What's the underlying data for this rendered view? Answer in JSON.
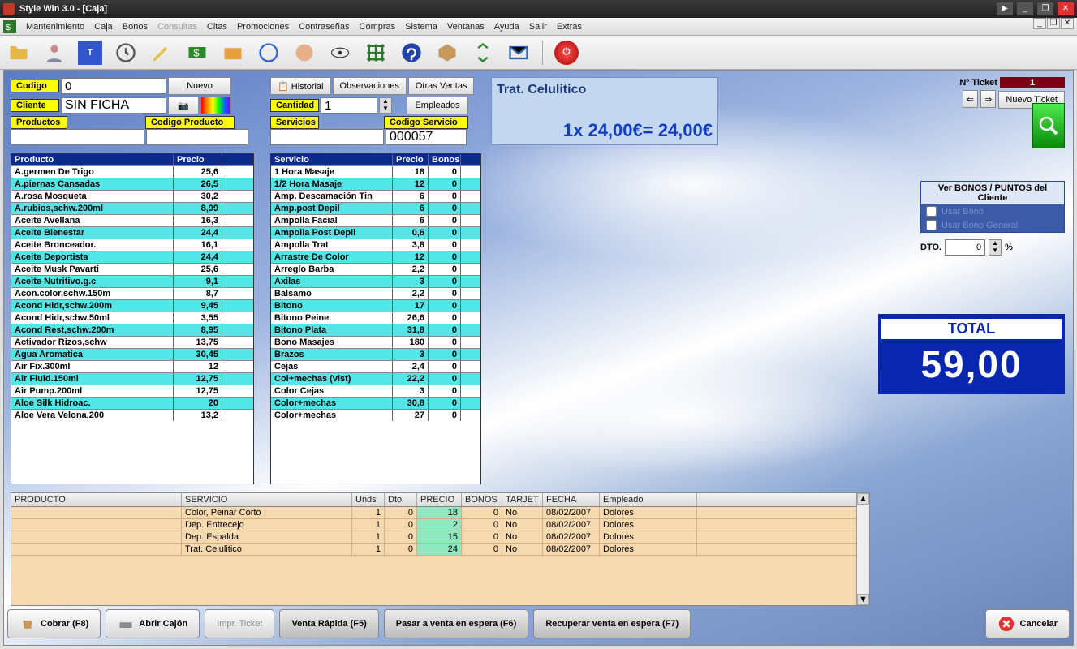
{
  "window": {
    "title": "Style Win 3.0 - [Caja]"
  },
  "menu": [
    "Mantenimiento",
    "Caja",
    "Bonos",
    "Consultas",
    "Citas",
    "Promociones",
    "Contraseñas",
    "Compras",
    "Sistema",
    "Ventanas",
    "Ayuda",
    "Salir",
    "Extras"
  ],
  "menu_disabled_index": 3,
  "top": {
    "codigo_label": "Codigo",
    "codigo_value": "0",
    "nuevo": "Nuevo",
    "cliente_label": "Cliente",
    "cliente_value": "SIN FICHA",
    "historial": "Historial",
    "observaciones": "Observaciones",
    "otras_ventas": "Otras Ventas",
    "cantidad_label": "Cantidad",
    "cantidad_value": "1",
    "empleados": "Empleados",
    "productos_label": "Productos",
    "codigo_producto_label": "Codigo Producto",
    "servicios_label": "Servicios",
    "codigo_servicio_label": "Codigo Servicio",
    "codigo_servicio_value": "000057"
  },
  "display": {
    "line1": "Trat. Celulitico",
    "line2": "1x 24,00€= 24,00€"
  },
  "ticket": {
    "label": "Nº Ticket",
    "number": "1",
    "nuevo": "Nuevo Ticket"
  },
  "right": {
    "ver_bonos": "Ver BONOS / PUNTOS del Cliente",
    "usar_bono": "Usar Bono",
    "usar_bono_gen": "Usar Bono General",
    "dto_label": "DTO.",
    "dto_value": "0",
    "pct": "%"
  },
  "total": {
    "label": "TOTAL",
    "value": "59,00"
  },
  "productos": {
    "hdr_name": "Producto",
    "hdr_price": "Precio",
    "rows": [
      {
        "n": "A.germen De Trigo",
        "p": "25,6"
      },
      {
        "n": "A.piernas Cansadas",
        "p": "26,5"
      },
      {
        "n": "A.rosa Mosqueta",
        "p": "30,2"
      },
      {
        "n": "A.rubios,schw.200ml",
        "p": "8,99"
      },
      {
        "n": "Aceite Avellana",
        "p": "16,3"
      },
      {
        "n": "Aceite Bienestar",
        "p": "24,4"
      },
      {
        "n": "Aceite Bronceador.",
        "p": "16,1"
      },
      {
        "n": "Aceite Deportista",
        "p": "24,4"
      },
      {
        "n": "Aceite Musk Pavarti",
        "p": "25,6"
      },
      {
        "n": "Aceite Nutritivo.g.c",
        "p": "9,1"
      },
      {
        "n": "Acon.color,schw.150m",
        "p": "8,7"
      },
      {
        "n": "Acond Hidr,schw.200m",
        "p": "9,45"
      },
      {
        "n": "Acond Hidr,schw.50ml",
        "p": "3,55"
      },
      {
        "n": "Acond Rest,schw.200m",
        "p": "8,95"
      },
      {
        "n": "Activador Rizos,schw",
        "p": "13,75"
      },
      {
        "n": "Agua Aromatica",
        "p": "30,45"
      },
      {
        "n": "Air Fix.300ml",
        "p": "12"
      },
      {
        "n": "Air Fluid.150ml",
        "p": "12,75"
      },
      {
        "n": "Air Pump.200ml",
        "p": "12,75"
      },
      {
        "n": "Aloe Silk Hidroac.",
        "p": "20"
      },
      {
        "n": "Aloe Vera Velona,200",
        "p": "13,2"
      }
    ]
  },
  "servicios": {
    "hdr_name": "Servicio",
    "hdr_price": "Precio",
    "hdr_bonos": "Bonos",
    "rows": [
      {
        "n": "1 Hora Masaje",
        "p": "18",
        "b": "0"
      },
      {
        "n": "1/2 Hora Masaje",
        "p": "12",
        "b": "0"
      },
      {
        "n": "Amp. Descamación Tin",
        "p": "6",
        "b": "0"
      },
      {
        "n": "Amp.post Depil",
        "p": "6",
        "b": "0"
      },
      {
        "n": "Ampolla Facial",
        "p": "6",
        "b": "0"
      },
      {
        "n": "Ampolla Post Depil",
        "p": "0,6",
        "b": "0"
      },
      {
        "n": "Ampolla Trat",
        "p": "3,8",
        "b": "0"
      },
      {
        "n": "Arrastre De Color",
        "p": "12",
        "b": "0"
      },
      {
        "n": "Arreglo Barba",
        "p": "2,2",
        "b": "0"
      },
      {
        "n": "Axilas",
        "p": "3",
        "b": "0"
      },
      {
        "n": "Balsamo",
        "p": "2,2",
        "b": "0"
      },
      {
        "n": "Bitono",
        "p": "17",
        "b": "0"
      },
      {
        "n": "Bitono Peine",
        "p": "26,6",
        "b": "0"
      },
      {
        "n": "Bitono Plata",
        "p": "31,8",
        "b": "0"
      },
      {
        "n": "Bono Masajes",
        "p": "180",
        "b": "0"
      },
      {
        "n": "Brazos",
        "p": "3",
        "b": "0"
      },
      {
        "n": "Cejas",
        "p": "2,4",
        "b": "0"
      },
      {
        "n": "Col+mechas (vist)",
        "p": "22,2",
        "b": "0"
      },
      {
        "n": "Color Cejas",
        "p": "3",
        "b": "0"
      },
      {
        "n": "Color+mechas",
        "p": "30,8",
        "b": "0"
      },
      {
        "n": "Color+mechas",
        "p": "27",
        "b": "0"
      }
    ]
  },
  "cart": {
    "hdr": [
      "PRODUCTO",
      "SERVICIO",
      "Unds",
      "Dto",
      "PRECIO",
      "BONOS",
      "TARJET",
      "FECHA",
      "Empleado"
    ],
    "rows": [
      {
        "prod": "",
        "serv": "Color, Peinar Corto",
        "u": "1",
        "d": "0",
        "p": "18",
        "b": "0",
        "t": "No",
        "f": "08/02/2007",
        "e": "Dolores"
      },
      {
        "prod": "",
        "serv": "Dep. Entrecejo",
        "u": "1",
        "d": "0",
        "p": "2",
        "b": "0",
        "t": "No",
        "f": "08/02/2007",
        "e": "Dolores"
      },
      {
        "prod": "",
        "serv": "Dep. Espalda",
        "u": "1",
        "d": "0",
        "p": "15",
        "b": "0",
        "t": "No",
        "f": "08/02/2007",
        "e": "Dolores"
      },
      {
        "prod": "",
        "serv": "Trat. Celulitico",
        "u": "1",
        "d": "0",
        "p": "24",
        "b": "0",
        "t": "No",
        "f": "08/02/2007",
        "e": "Dolores"
      }
    ]
  },
  "footer": {
    "cobrar": "Cobrar (F8)",
    "abrir": "Abrir Cajón",
    "impr": "Impr. Ticket",
    "rapida": "Venta Rápida (F5)",
    "pasar": "Pasar a venta en espera (F6)",
    "recuperar": "Recuperar venta en espera (F7)",
    "cancelar": "Cancelar"
  }
}
